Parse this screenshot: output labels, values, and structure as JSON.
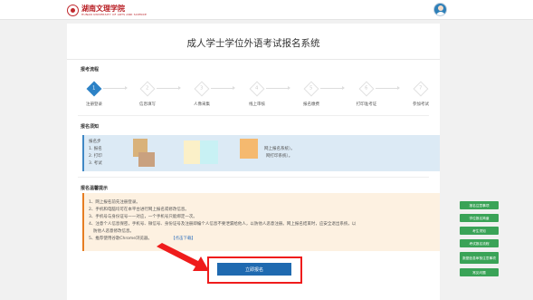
{
  "header": {
    "logo_cn": "湖南文理学院",
    "logo_en": "HUNAN UNIVERSITY OF ARTS AND SCIENCE"
  },
  "page": {
    "title": "成人学士学位外语考试报名系统"
  },
  "process": {
    "heading": "报考流程",
    "steps": [
      {
        "num": "1",
        "label": "注册登录"
      },
      {
        "num": "2",
        "label": "信息填写"
      },
      {
        "num": "3",
        "label": "人像采集"
      },
      {
        "num": "4",
        "label": "线上审核"
      },
      {
        "num": "5",
        "label": "报名缴费"
      },
      {
        "num": "6",
        "label": "打印准考证"
      },
      {
        "num": "7",
        "label": "参加考试"
      }
    ]
  },
  "notice": {
    "heading": "报名须知",
    "line1": "报名步",
    "line2": "1. 报名",
    "line2_tail": "网上报名系统）。",
    "line3": "2. 打印",
    "line3_tail": "网打印系统）。",
    "line4": "3. 考试"
  },
  "tips": {
    "heading": "报名温馨提示",
    "items": [
      "1、网上报名前先注册登录。",
      "2、手机和电脑均可在本平台进行网上报名或修改信息。",
      "3、手机号与身份证号一一对应，一个手机号只能绑定一次。",
      "4、注意个人信息保密，手机号、微信号、身份证号及注册即编个人信息不要泄漏给他人，以防他人恶意注册。网上报名结束时，应安全退出系统，以",
      "防他人恶意修改信息。",
      "5、推荐使用谷歌Chrome浏览器。"
    ],
    "download_link": "【点击下载】"
  },
  "actions": {
    "apply_label": "立即报名"
  },
  "sidebar": {
    "buttons": [
      "报名注意事项",
      "学位报名简章",
      "考生须知",
      "考试报名流程",
      "数据信息审核注意事项",
      "常见问题"
    ]
  },
  "colors": {
    "brand_red": "#b81c22",
    "step_active": "#2d82c6",
    "apply_button": "#1f6ab0",
    "side_button": "#3aa357",
    "annotation_red": "#ef1c1c"
  }
}
